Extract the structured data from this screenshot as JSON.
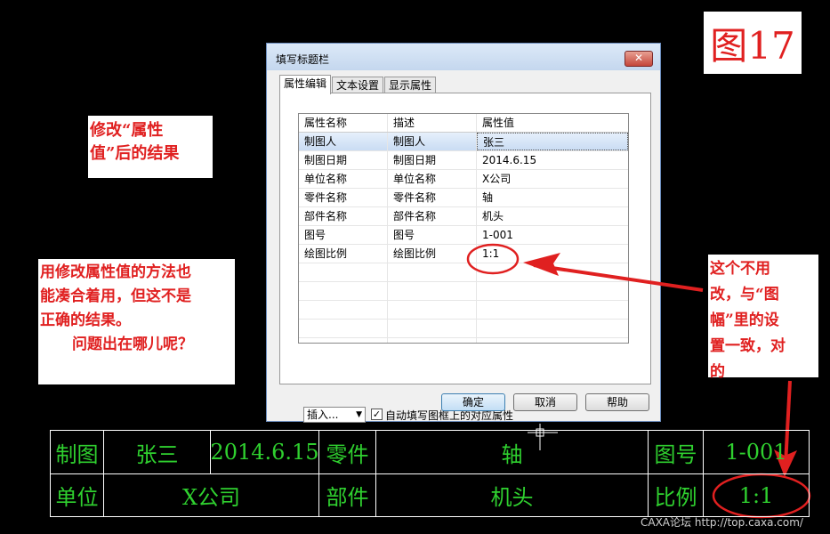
{
  "figure_label": "图17",
  "notes": {
    "note1": [
      "修改“属性",
      "值”后的结果"
    ],
    "note2": [
      "用修改属性值的方法也",
      "能凑合着用，但这不是",
      "正确的结果。",
      "问题出在哪儿呢？"
    ],
    "note3": [
      "这个不用",
      "改，与“图",
      "幅”里的设",
      "置一致，对",
      "的"
    ]
  },
  "dialog": {
    "title": "填写标题栏",
    "close_label": "✕",
    "tabs": [
      {
        "label": "属性编辑",
        "active": true
      },
      {
        "label": "文本设置",
        "active": false
      },
      {
        "label": "显示属性",
        "active": false
      }
    ],
    "table": {
      "columns": [
        "属性名称",
        "描述",
        "属性值"
      ],
      "rows": [
        [
          "制图人",
          "制图人",
          "张三"
        ],
        [
          "制图日期",
          "制图日期",
          "2014.6.15"
        ],
        [
          "单位名称",
          "单位名称",
          "X公司"
        ],
        [
          "零件名称",
          "零件名称",
          "轴"
        ],
        [
          "部件名称",
          "部件名称",
          "机头"
        ],
        [
          "图号",
          "图号",
          "1-001"
        ],
        [
          "绘图比例",
          "绘图比例",
          "1:1"
        ]
      ],
      "selected_row": 0
    },
    "insert_select": "插入...",
    "auto_fill_checked": true,
    "auto_fill_label": "自动填写图框上的对应属性",
    "buttons": {
      "ok": "确定",
      "cancel": "取消",
      "help": "帮助"
    }
  },
  "title_block": {
    "row1": [
      "制图",
      "张三",
      "2014.6.15",
      "零件",
      "轴",
      "图号",
      "1-001"
    ],
    "row2": [
      "单位",
      "X公司",
      "部件",
      "机头",
      "比例",
      "1:1"
    ]
  },
  "watermark": "CAXA论坛 http://top.caxa.com/",
  "colors": {
    "annotation": "#e02020",
    "cad_text": "#2fd02f",
    "background": "#000000"
  }
}
